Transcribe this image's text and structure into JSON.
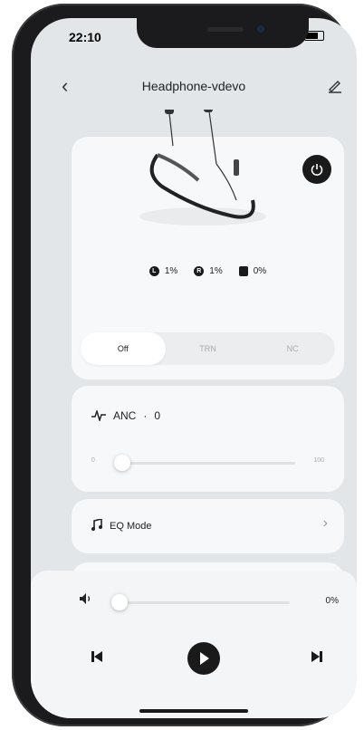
{
  "status": {
    "time": "22:10"
  },
  "header": {
    "title": "Headphone-vdevo"
  },
  "device": {
    "battery_left": "1%",
    "battery_right": "1%",
    "battery_case": "0%",
    "modes": [
      "Off",
      "TRN",
      "NC"
    ],
    "active_mode": "Off"
  },
  "anc": {
    "label": "ANC",
    "separator": "·",
    "value": "0",
    "min": "0",
    "max": "100",
    "level_fraction": 0
  },
  "eq": {
    "label": "EQ Mode"
  },
  "player": {
    "volume_value": "0%",
    "volume_fraction": 0
  },
  "icons": [
    "back-arrow-icon",
    "pencil-icon",
    "power-icon",
    "waveform-icon",
    "music-note-icon",
    "chevron-right-icon",
    "speaker-icon",
    "skip-previous-icon",
    "play-icon",
    "skip-next-icon"
  ]
}
